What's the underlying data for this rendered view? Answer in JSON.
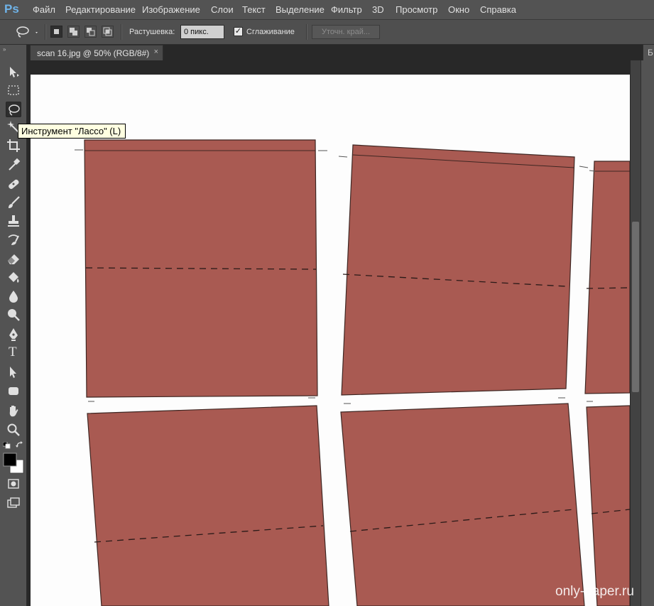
{
  "app": {
    "logo": "Ps"
  },
  "menu": [
    "Файл",
    "Редактирование",
    "Изображение",
    "Слои",
    "Текст",
    "Выделение",
    "Фильтр",
    "3D",
    "Просмотр",
    "Окно",
    "Справка"
  ],
  "options": {
    "tool_icon": "lasso-icon",
    "feather_label": "Растушевка:",
    "feather_value": "0 пикс.",
    "antialias_label": "Сглаживание",
    "antialias_checked": true,
    "refine_edge_label": "Уточн. край..."
  },
  "document_tab": {
    "title": "scan 16.jpg @ 50% (RGB/8#)",
    "close_symbol": "×"
  },
  "right_panel_tab": "Б",
  "tooltip": "Инструмент \"Лассо\" (L)",
  "tools": [
    "move-icon",
    "marquee-icon",
    "lasso-icon",
    "magic-wand-icon",
    "crop-icon",
    "eyedropper-icon",
    "healing-brush-icon",
    "brush-icon",
    "clone-stamp-icon",
    "history-brush-icon",
    "eraser-icon",
    "paint-bucket-icon",
    "blur-icon",
    "dodge-icon",
    "pen-icon",
    "type-icon",
    "path-selection-icon",
    "shape-icon",
    "hand-icon",
    "zoom-icon",
    "default-colors-icon",
    "swap-colors-icon",
    "color-swatches-icon",
    "quick-mask-icon",
    "screen-mode-icon"
  ],
  "type_tool_glyph": "T",
  "colors": {
    "foreground": "#000000",
    "background": "#ffffff",
    "paper_piece": "#a95a52"
  },
  "watermark": "only-paper.ru"
}
